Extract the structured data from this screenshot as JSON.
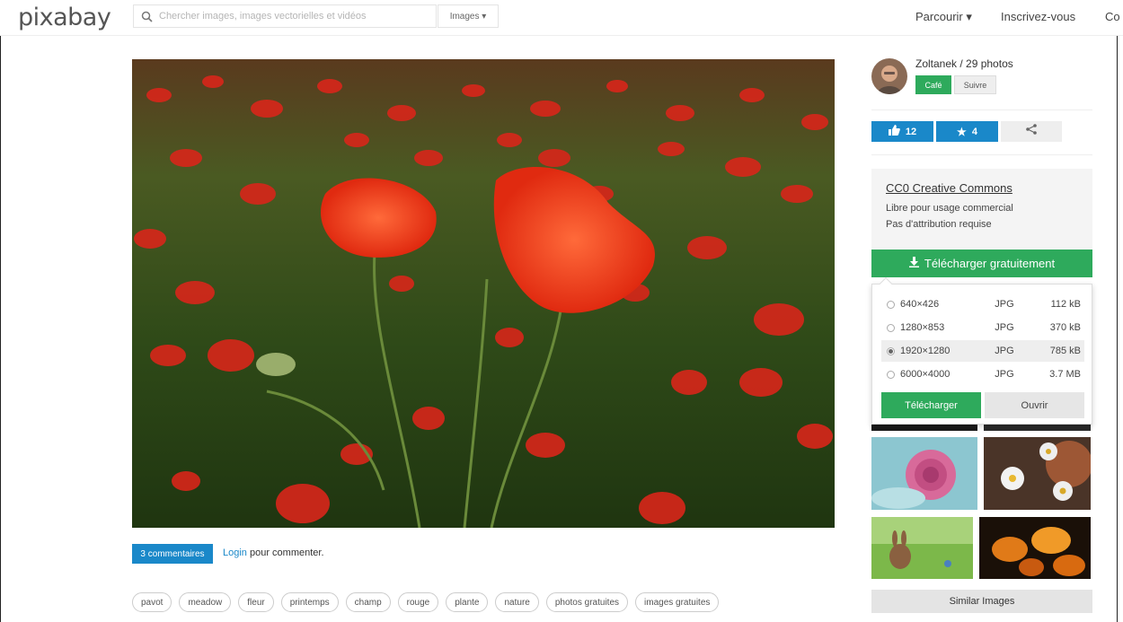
{
  "header": {
    "logo": "pixabay",
    "search_placeholder": "Chercher images, images vectorielles et vidéos",
    "type_select": "Images ▾",
    "nav": [
      "Parcourir ▾",
      "Inscrivez-vous",
      "Co"
    ]
  },
  "user": {
    "name_line": "Zoltanek / 29 photos",
    "coffee_label": "Café",
    "follow_label": "Suivre"
  },
  "actions": {
    "likes": "12",
    "favorites": "4"
  },
  "license": {
    "title": "CC0 Creative Commons",
    "line1": "Libre pour usage commercial",
    "line2": "Pas d'attribution requise"
  },
  "download": {
    "button_label": "Télécharger gratuitement",
    "options": [
      {
        "size": "640×426",
        "format": "JPG",
        "filesize": "112 kB",
        "selected": false
      },
      {
        "size": "1280×853",
        "format": "JPG",
        "filesize": "370 kB",
        "selected": false
      },
      {
        "size": "1920×1280",
        "format": "JPG",
        "filesize": "785 kB",
        "selected": true
      },
      {
        "size": "6000×4000",
        "format": "JPG",
        "filesize": "3.7 MB",
        "selected": false
      }
    ],
    "download_label": "Télécharger",
    "open_label": "Ouvrir"
  },
  "comments": {
    "count_label": "3 commentaires",
    "login_label": "Login",
    "suffix": " pour commenter."
  },
  "tags": [
    "pavot",
    "meadow",
    "fleur",
    "printemps",
    "champ",
    "rouge",
    "plante",
    "nature",
    "photos gratuites",
    "images gratuites"
  ],
  "similar_label": "Similar Images",
  "colors": {
    "accent_blue": "#1a88c9",
    "accent_green": "#2eaa5c"
  }
}
